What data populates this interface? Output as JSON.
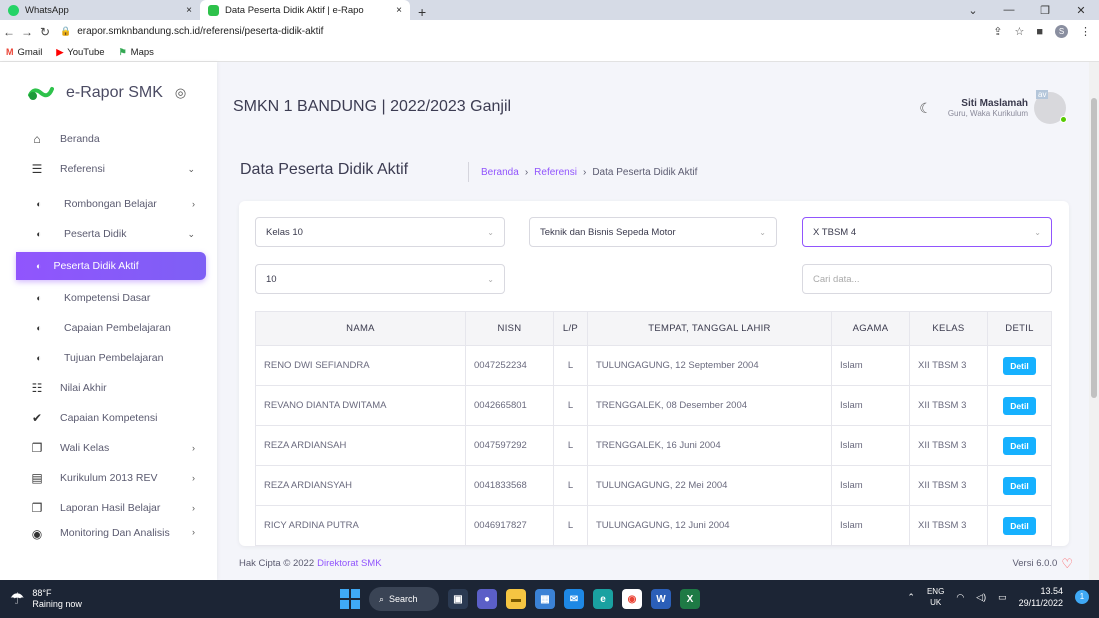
{
  "browser": {
    "tabs": [
      {
        "title": "WhatsApp",
        "close": "×"
      },
      {
        "title": "Data Peserta Didik Aktif | e-Rapo",
        "close": "×"
      }
    ],
    "new_tab": "+",
    "url": "erapor.smknbandung.sch.id/referensi/peserta-didik-aktif",
    "bookmarks": [
      "Gmail",
      "YouTube",
      "Maps"
    ]
  },
  "sidebar": {
    "brand": "e-Rapor SMK",
    "items": [
      {
        "label": "Beranda",
        "icon": "home-icon"
      },
      {
        "label": "Referensi",
        "icon": "list-icon",
        "arrow": "⌄"
      },
      {
        "label": "Rombongan Belajar",
        "icon": "circle-icon",
        "arrow": "›"
      },
      {
        "label": "Peserta Didik",
        "icon": "circle-icon",
        "arrow": "⌄"
      },
      {
        "label": "Peserta Didik Aktif",
        "icon": "circle-icon"
      },
      {
        "label": "Kompetensi Dasar",
        "icon": "circle-icon"
      },
      {
        "label": "Capaian Pembelajaran",
        "icon": "circle-icon"
      },
      {
        "label": "Tujuan Pembelajaran",
        "icon": "circle-icon"
      },
      {
        "label": "Nilai Akhir",
        "icon": "checklist-icon"
      },
      {
        "label": "Capaian Kompetensi",
        "icon": "check-icon"
      },
      {
        "label": "Wali Kelas",
        "icon": "copy-icon",
        "arrow": "›"
      },
      {
        "label": "Kurikulum 2013 REV",
        "icon": "chart-icon",
        "arrow": "›"
      },
      {
        "label": "Laporan Hasil Belajar",
        "icon": "copy-icon",
        "arrow": "›"
      },
      {
        "label": "Monitoring Dan Analisis",
        "icon": "monitor-icon",
        "arrow": "›"
      }
    ]
  },
  "header": {
    "school": "SMKN 1 BANDUNG | 2022/2023 Ganjil",
    "user_name": "Siti Maslamah",
    "user_role": "Guru, Waka Kurikulum",
    "avatar_alt": "av"
  },
  "page": {
    "title": "Data Peserta Didik Aktif",
    "breadcrumb": [
      "Beranda",
      "Referensi",
      "Data Peserta Didik Aktif"
    ],
    "filters": {
      "kelas": "Kelas 10",
      "jurusan": "Teknik dan Bisnis Sepeda Motor",
      "rombel": "X TBSM 4",
      "per_page": "10",
      "search_placeholder": "Cari data..."
    },
    "table": {
      "headers": [
        "NAMA",
        "NISN",
        "L/P",
        "TEMPAT, TANGGAL LAHIR",
        "AGAMA",
        "KELAS",
        "DETIL"
      ],
      "rows": [
        {
          "nama": "RENO DWI SEFIANDRA",
          "nisn": "0047252234",
          "lp": "L",
          "ttl": "TULUNGAGUNG, 12 September 2004",
          "agama": "Islam",
          "kelas": "XII TBSM 3",
          "detil": "Detil"
        },
        {
          "nama": "REVANO DIANTA DWITAMA",
          "nisn": "0042665801",
          "lp": "L",
          "ttl": "TRENGGALEK, 08 Desember 2004",
          "agama": "Islam",
          "kelas": "XII TBSM 3",
          "detil": "Detil"
        },
        {
          "nama": "REZA ARDIANSAH",
          "nisn": "0047597292",
          "lp": "L",
          "ttl": "TRENGGALEK, 16 Juni 2004",
          "agama": "Islam",
          "kelas": "XII TBSM 3",
          "detil": "Detil"
        },
        {
          "nama": "REZA ARDIANSYAH",
          "nisn": "0041833568",
          "lp": "L",
          "ttl": "TULUNGAGUNG, 22 Mei 2004",
          "agama": "Islam",
          "kelas": "XII TBSM 3",
          "detil": "Detil"
        },
        {
          "nama": "RICY ARDINA PUTRA",
          "nisn": "0046917827",
          "lp": "L",
          "ttl": "TULUNGAGUNG, 12 Juni 2004",
          "agama": "Islam",
          "kelas": "XII TBSM 3",
          "detil": "Detil"
        }
      ]
    }
  },
  "footer": {
    "copyright": "Hak Cipta © 2022",
    "link": "Direktorat SMK",
    "version": "Versi 6.0.0"
  },
  "taskbar": {
    "temp": "88°F",
    "weather": "Raining now",
    "search": "Search",
    "lang1": "ENG",
    "lang2": "UK",
    "time": "13.54",
    "date": "29/11/2022",
    "notif": "1"
  },
  "colors": {
    "accent": "#9155fd",
    "info": "#16b1ff",
    "brand_green": "#2ec24b"
  }
}
